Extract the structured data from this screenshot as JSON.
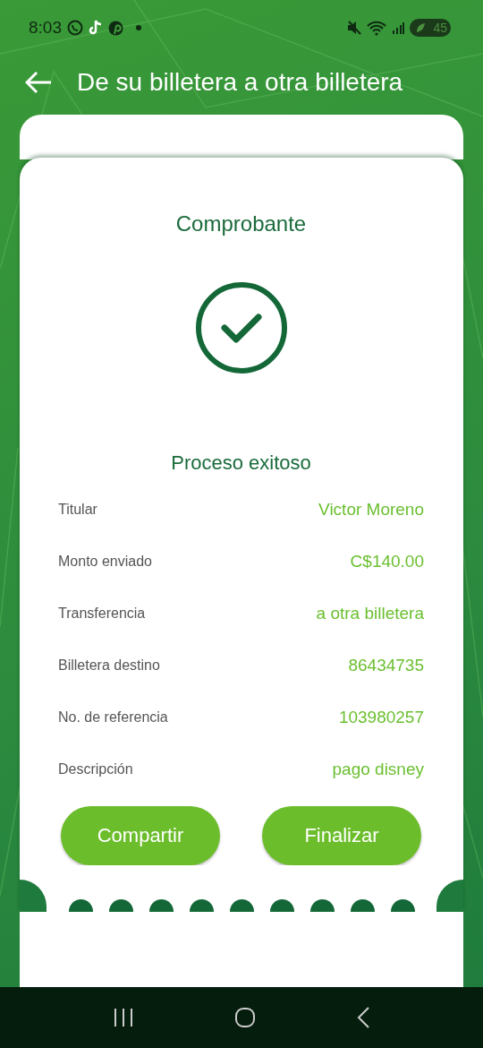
{
  "status_bar": {
    "time": "8:03",
    "battery": "45"
  },
  "header": {
    "title": "De su billetera a otra billetera"
  },
  "receipt": {
    "title": "Comprobante",
    "status": "Proceso exitoso",
    "rows": [
      {
        "label": "Titular",
        "value": "Victor Moreno"
      },
      {
        "label": "Monto enviado",
        "value": "C$140.00"
      },
      {
        "label": "Transferencia",
        "value": "a otra billetera"
      },
      {
        "label": "Billetera destino",
        "value": "86434735"
      },
      {
        "label": "No. de referencia",
        "value": "103980257"
      },
      {
        "label": "Descripción",
        "value": "pago disney"
      }
    ],
    "buttons": [
      "Compartir",
      "Finalizar"
    ]
  }
}
